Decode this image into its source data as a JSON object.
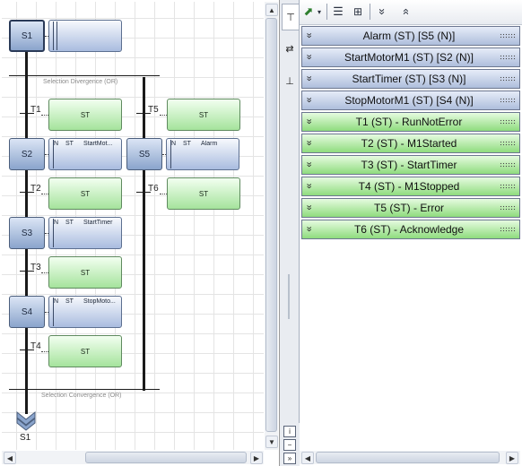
{
  "diagram": {
    "steps": [
      {
        "label": "S1",
        "initial": true
      },
      {
        "label": "S2",
        "initial": false
      },
      {
        "label": "S3",
        "initial": false
      },
      {
        "label": "S4",
        "initial": false
      },
      {
        "label": "S5",
        "initial": false
      }
    ],
    "actions": [
      {
        "qualifier": "",
        "language": "",
        "name": ""
      },
      {
        "qualifier": "N",
        "language": "ST",
        "name": "StartMot..."
      },
      {
        "qualifier": "N",
        "language": "ST",
        "name": "StartTimer"
      },
      {
        "qualifier": "N",
        "language": "ST",
        "name": "StopMoto..."
      },
      {
        "qualifier": "N",
        "language": "ST",
        "name": "Alarm"
      }
    ],
    "transitions": [
      {
        "label": "T1",
        "condition_lang": "ST"
      },
      {
        "label": "T2",
        "condition_lang": "ST"
      },
      {
        "label": "T3",
        "condition_lang": "ST"
      },
      {
        "label": "T4",
        "condition_lang": "ST"
      },
      {
        "label": "T5",
        "condition_lang": "ST"
      },
      {
        "label": "T6",
        "condition_lang": "ST"
      }
    ],
    "divergence_caption": "Selection Divergence (OR)",
    "convergence_caption": "Selection Convergence (OR)",
    "jump_target": "S1"
  },
  "side_tabs": [
    "steps-transitions-icon",
    "swap-icon",
    "pin-icon"
  ],
  "toolbar": {
    "icons": [
      "insert-icon",
      "dropdown-arrow-icon",
      "layout-rows-icon",
      "layout-grid-icon",
      "expand-all-icon",
      "collapse-all-icon"
    ]
  },
  "list": {
    "rows": [
      {
        "label": "Alarm (ST) [S5 (N)]",
        "kind": "step"
      },
      {
        "label": "StartMotorM1 (ST) [S2 (N)]",
        "kind": "step"
      },
      {
        "label": "StartTimer (ST) [S3 (N)]",
        "kind": "step"
      },
      {
        "label": "StopMotorM1 (ST) [S4 (N)]",
        "kind": "step"
      },
      {
        "label": "T1 (ST) - RunNotError",
        "kind": "transition"
      },
      {
        "label": "T2 (ST) - M1Started",
        "kind": "transition"
      },
      {
        "label": "T3 (ST) - StartTimer",
        "kind": "transition"
      },
      {
        "label": "T4 (ST) - M1Stopped",
        "kind": "transition"
      },
      {
        "label": "T5 (ST) - Error",
        "kind": "transition"
      },
      {
        "label": "T6 (ST) - Acknowledge",
        "kind": "transition"
      }
    ]
  },
  "colors": {
    "step_row": "#aebedc",
    "transition_row": "#8fdc7e",
    "step_box": "#8aa4cc",
    "condition_box": "#a5e39c"
  }
}
